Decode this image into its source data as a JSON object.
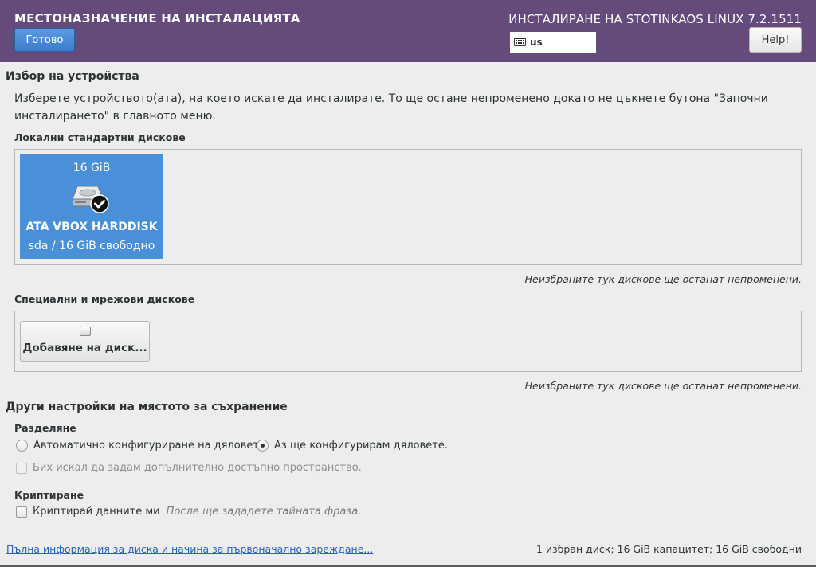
{
  "header": {
    "spoke_title": "МЕСТОНАЗНАЧЕНИЕ НА ИНСТАЛАЦИЯТА",
    "done_label": "Готово",
    "product_title": "ИНСТАЛИРАНЕ НА STOTINKAOS LINUX 7.2.1511",
    "keyboard_layout": "us",
    "help_label": "Help!"
  },
  "device_selection": {
    "title": "Избор на устройства",
    "description_line1": "Изберете устройството(ата), на което искате да инсталирате.  То ще остане непроменено докато не цъкнете бутона \"Започни",
    "description_line2": "инсталирането\" в главното меню.",
    "local_disks_title": "Локални стандартни дискове",
    "disk": {
      "size": "16 GiB",
      "name": "ATA VBOX HARDDISK",
      "info": "sda  /  16 GiB свободно",
      "selected": true
    },
    "local_note": "Неизбраните тук дискове ще останат непроменени.",
    "special_disks_title": "Специални и мрежови дискове",
    "add_disk_label": "Добавяне на диск...",
    "special_note": "Неизбраните тук дискове ще останат непроменени."
  },
  "other_options": {
    "title": "Други настройки на мястото за съхранение",
    "partitioning_title": "Разделяне",
    "auto_label": "Автоматично конфигуриране на дяловете.",
    "manual_label": "Аз ще конфигурирам дяловете.",
    "manual_selected": true,
    "extra_space_label": "Бих искал да задам допълнително достъпно пространство.",
    "encryption_title": "Криптиране",
    "encrypt_label": "Криптирай данните ми",
    "encrypt_hint": "После ще зададете тайната фраза."
  },
  "footer": {
    "link_label": "Пълна информация за диска и начина за първоначално зареждане...",
    "summary": "1 избран диск; 16 GiB капацитет; 16 GiB свободни"
  },
  "colors": {
    "header_bg": "#644b7c",
    "accent_blue": "#4a90d9",
    "link_blue": "#2a62b8"
  }
}
